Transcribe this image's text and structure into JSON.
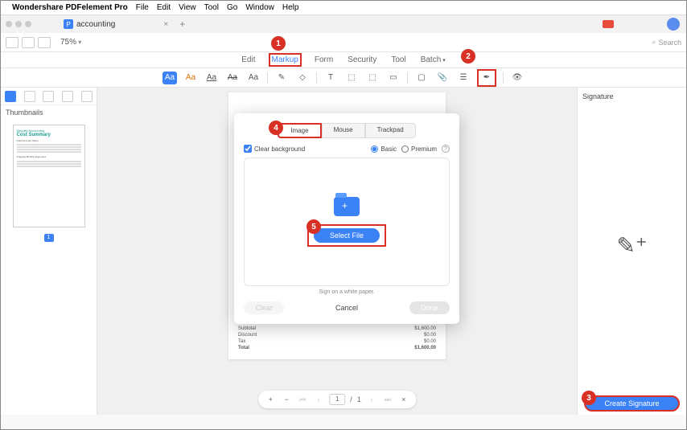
{
  "menubar": {
    "app_name": "Wondershare PDFelement Pro",
    "items": [
      "File",
      "Edit",
      "View",
      "Tool",
      "Go",
      "Window",
      "Help"
    ]
  },
  "tab": {
    "title": "accounting"
  },
  "toolbar": {
    "zoom": "75%"
  },
  "main_tabs": [
    "Edit",
    "Markup",
    "Form",
    "Security",
    "Tool",
    "Batch"
  ],
  "main_tabs_active": "Markup",
  "sidebar": {
    "title": "Thumbnails",
    "page_badge": "1"
  },
  "thumb": {
    "heading": "Cost Summary",
    "subhead": "Simplify Accounting"
  },
  "page_table": {
    "rows": [
      {
        "label": "Subtotal",
        "value": "$1,600.00"
      },
      {
        "label": "Discount",
        "value": "$0.00"
      },
      {
        "label": "Tax",
        "value": "$0.00"
      },
      {
        "label": "Total",
        "value": "$1,600.00"
      }
    ]
  },
  "pager": {
    "current": "1",
    "total": "1"
  },
  "right": {
    "title": "Signature",
    "create_btn": "Create Signature"
  },
  "search": {
    "placeholder": "Search"
  },
  "modal": {
    "seg": [
      "Image",
      "Mouse",
      "Trackpad"
    ],
    "clear_bg": "Clear background",
    "basic": "Basic",
    "premium": "Premium",
    "select_file": "Select File",
    "hint": "Sign on a white paper.",
    "clear": "Clear",
    "cancel": "Cancel",
    "done": "Done"
  },
  "callouts": {
    "1": "1",
    "2": "2",
    "3": "3",
    "4": "4",
    "5": "5"
  }
}
